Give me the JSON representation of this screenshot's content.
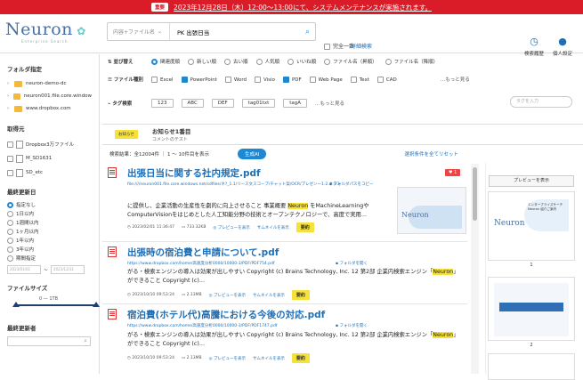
{
  "banner": {
    "tag": "重要",
    "message": "2023年12月28日（木）12:00～13:00にて、システムメンテナンスが実施されます。"
  },
  "header": {
    "logo": "Neuron",
    "logo_sub": "Enterprise Search",
    "scope_placeholder": "内容+ファイル名",
    "query": "PK 出張日当",
    "exact_label": "完全一致",
    "advanced_label": "詳細検索",
    "history_label": "検索履歴",
    "settings_label": "個人設定"
  },
  "sidebar": {
    "folder_title": "フォルダ指定",
    "folders": [
      {
        "label": "neuron-demo-dc"
      },
      {
        "label": "neuron001.file.core.window"
      },
      {
        "label": "www.dropbox.com"
      }
    ],
    "source_title": "取得元",
    "sources": [
      {
        "label": "Dropbox3万ファイル"
      },
      {
        "label": "M_SD1631"
      },
      {
        "label": "SD_etc"
      }
    ],
    "date_title": "最終更新日",
    "date_options": [
      {
        "label": "指定なし",
        "checked": true
      },
      {
        "label": "1日以内",
        "checked": false
      },
      {
        "label": "1週間以内",
        "checked": false
      },
      {
        "label": "1ヶ月以内",
        "checked": false
      },
      {
        "label": "1年以内",
        "checked": false
      },
      {
        "label": "3年以内",
        "checked": false
      },
      {
        "label": "期間指定",
        "checked": false
      }
    ],
    "date_from": "2023/01/01",
    "date_to": "2023/12/31",
    "size_title": "ファイルサイズ",
    "size_range": "0 ― 1TB",
    "updater_title": "最終更新者"
  },
  "filters": {
    "sort_title": "並び替え",
    "sort_options": [
      {
        "label": "関連度順",
        "checked": true
      },
      {
        "label": "新しい順",
        "checked": false
      },
      {
        "label": "古い順",
        "checked": false
      },
      {
        "label": "人気順",
        "checked": false
      },
      {
        "label": "いいね順",
        "checked": false
      },
      {
        "label": "ファイル名（昇順）",
        "checked": false
      },
      {
        "label": "ファイル名（降順）",
        "checked": false
      }
    ],
    "type_title": "ファイル種別",
    "types": [
      {
        "label": "Excel",
        "checked": false
      },
      {
        "label": "PowerPoint",
        "checked": true
      },
      {
        "label": "Word",
        "checked": false
      },
      {
        "label": "Visio",
        "checked": false
      },
      {
        "label": "PDF",
        "checked": true
      },
      {
        "label": "Web Page",
        "checked": false
      },
      {
        "label": "Text",
        "checked": false
      },
      {
        "label": "CAD",
        "checked": false
      }
    ],
    "type_more": "…もっと見る",
    "tag_title": "タグ検索",
    "tags": [
      {
        "label": "123"
      },
      {
        "label": "ABC"
      },
      {
        "label": "DEF"
      },
      {
        "label": "tag01txt"
      },
      {
        "label": "tagA"
      }
    ],
    "tag_more": "…もっと見る",
    "tag_search_placeholder": "タグを入力"
  },
  "notice": {
    "badge": "お知らせ",
    "title": "お知らせ1番目",
    "body": "コメントのテスト"
  },
  "resultbar": {
    "count": "検索結果：全12004件 ｜ 1 ～ 10件目を表示",
    "ai_button": "生成AI",
    "save_label": "選択条件を全てリセット"
  },
  "results": [
    {
      "title": "出張日当に関する社内規定.pdf",
      "url": "file:////neuron001.file.core.windows.net/sdfiles/ネ?_1.1/リース文スコープ/チャット案/OCR/プレゼン一1.2.ネタ3ページ目.pdf",
      "folder_link": "フォルダパスをコピー",
      "snippet": [
        "に提供し、企業活動の生産性を劇的に向上させること 事業概要 ",
        "Neuron",
        " をMachineLearningや",
        "ComputerVisionをはじめとした人工知能分野の技術とオープンテクノロジーで、高度で実用…"
      ],
      "date": "2023/02/01 11:36:47",
      "size": "733.32KB",
      "preview_link": "プレビューを表示",
      "thumb_link": "サムネイルを表示",
      "yoyaku": "要約",
      "likes": "♥ 1"
    },
    {
      "title": "出張時の宿泊費と申請について.pdf",
      "url": "https://www.dropbox.com/home/高速度分析0000/10000-3/PDF/PDF754.pdf",
      "folder_link": "フォルダを開く",
      "snippet": [
        "がる・検索エンジンの導入は効果が出しやすい Copyright (c) Brains Technology, Inc. 12 第2部 企業内検索エンジン「",
        "Neuron",
        "」",
        "ができること Copyright (c)…"
      ],
      "date": "2023/10/10 09:53:24",
      "size": "2.13MB",
      "preview_link": "プレビューを表示",
      "thumb_link": "サムネイルを表示",
      "yoyaku": "要約"
    },
    {
      "title": "宿泊費(ホテル代)高騰における今後の対応.pdf",
      "url": "https://www.dropbox.com/home/高速度分析0000/10000-3/PDF/PDF1747.pdf",
      "folder_link": "フォルダを開く",
      "snippet": [
        "がる・検索エンジンの導入は効果が出しやすい Copyright (c) Brains Technology, Inc. 12 第2部 企業内検索エンジン「",
        "Neuron",
        "」",
        "ができること Copyright (c)…"
      ],
      "date": "2023/10/10 09:53:24",
      "size": "2.13MB",
      "preview_link": "プレビューを表示",
      "thumb_link": "サムネイルを表示",
      "yoyaku": "要約"
    }
  ],
  "preview": {
    "button": "プレビューを表示",
    "pages": [
      "1",
      "2"
    ],
    "slide_caption": "エンタープライズサーチ\nNeuron 紹介ご案内"
  }
}
